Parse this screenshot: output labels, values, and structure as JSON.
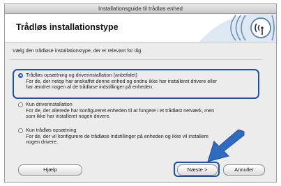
{
  "window": {
    "title": "Installationsguide til trådløs enhed"
  },
  "header": {
    "title": "Trådløs installationstype",
    "logo_icon": "wireless-signal-icon"
  },
  "main": {
    "prompt": "Vælg den trådløse installationstype, der er relevant for dig.",
    "options": [
      {
        "label": "Trådløs opsætning og driverinstallation (anbefalet)",
        "desc_line1": "For de, der netop har anskaffet denne enhed og endnu ikke har installeret drivere eller",
        "desc_line2": "har ændret nogen af de trådløse indstillinger på enheden.",
        "selected": true
      },
      {
        "label": "Kun driverinstallation",
        "desc_line1": "For de, der allerede har konfigureret enheden til at fungere i et trådløst netværk, men",
        "desc_line2": "som ikke har installeret nogen drivere.",
        "selected": false
      },
      {
        "label": "Kun trådløs opsætning",
        "desc_line1": "For de, der vil konfigurere de trådløse indstillinger på enheden og ikke vil installere",
        "desc_line2": "nogen drivere.",
        "selected": false
      }
    ]
  },
  "footer": {
    "help_label": "Hjælp",
    "next_label": "Næste >",
    "cancel_label": "Annuller"
  },
  "colors": {
    "highlight": "#1f4f9e",
    "arrow": "#2f6bbf",
    "radio_selected": "#3a78c8"
  }
}
